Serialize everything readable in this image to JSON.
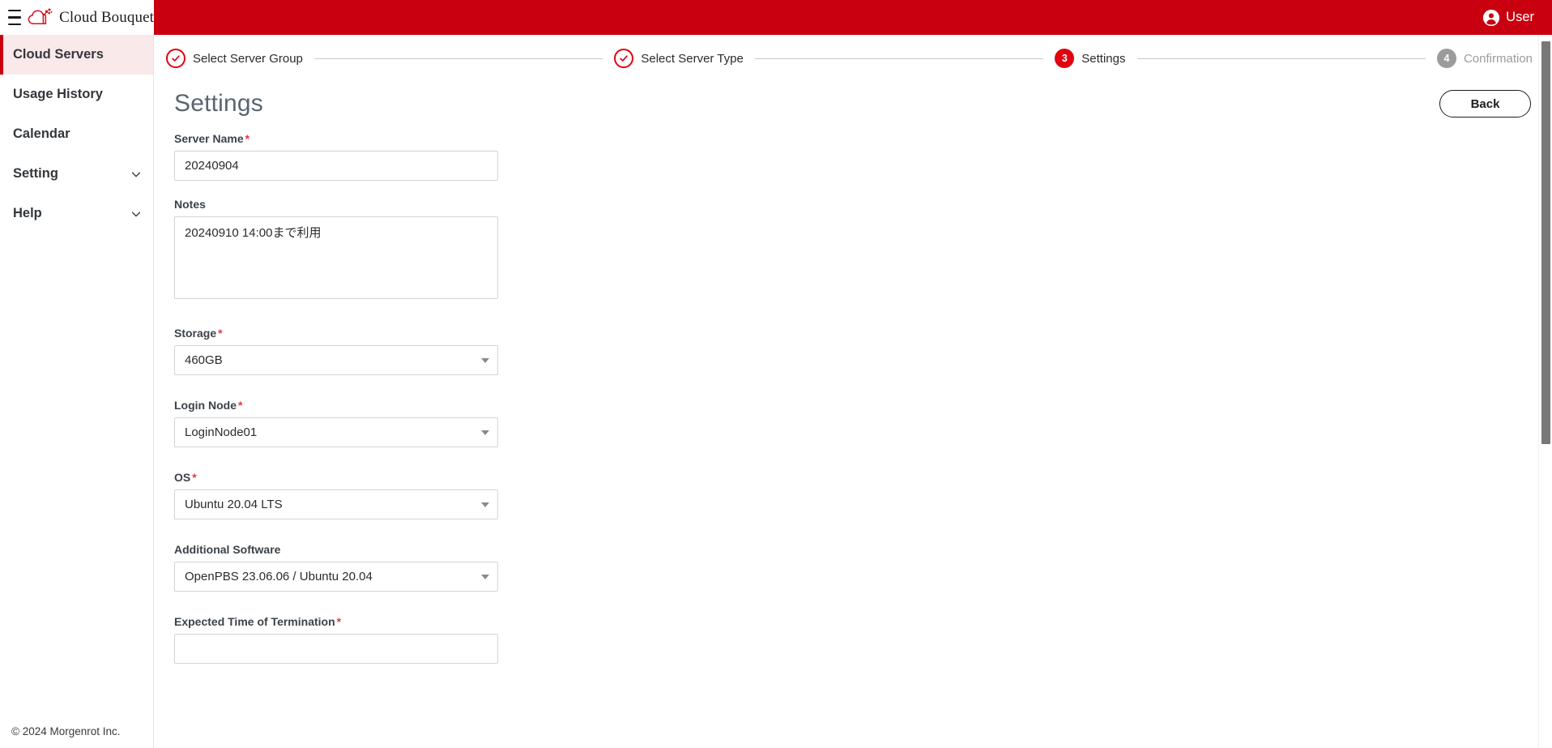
{
  "topbar": {
    "menu_icon": "hamburger-icon",
    "brand": "Cloud Bouquet",
    "logo_icon": "cloud-bouquet-logo",
    "user_icon": "user-avatar-icon",
    "user_label": "User",
    "background_color": "#c9000f"
  },
  "sidebar": {
    "items": [
      {
        "label": "Cloud Servers",
        "active": true,
        "expandable": false
      },
      {
        "label": "Usage History",
        "active": false,
        "expandable": false
      },
      {
        "label": "Calendar",
        "active": false,
        "expandable": false
      },
      {
        "label": "Setting",
        "active": false,
        "expandable": true,
        "chevron_icon": "chevron-down-icon"
      },
      {
        "label": "Help",
        "active": false,
        "expandable": true,
        "chevron_icon": "chevron-down-icon"
      }
    ],
    "active_accent_color": "#c9000f",
    "active_background_color": "#fae9ea",
    "footer": "© 2024 Morgenrot Inc."
  },
  "stepper": {
    "steps": [
      {
        "badge": "check-icon",
        "number": "1",
        "label": "Select Server Group",
        "state": "done"
      },
      {
        "badge": "check-icon",
        "number": "2",
        "label": "Select Server Type",
        "state": "done"
      },
      {
        "badge": "3",
        "number": "3",
        "label": "Settings",
        "state": "current"
      },
      {
        "badge": "4",
        "number": "4",
        "label": "Confirmation",
        "state": "todo"
      }
    ],
    "done_color": "#e2000f",
    "current_color": "#e2000f",
    "todo_color": "#9b9b9b"
  },
  "page": {
    "title": "Settings",
    "back_button": "Back"
  },
  "form": {
    "fields": [
      {
        "name": "server-name",
        "label": "Server Name",
        "required": true,
        "type": "text",
        "value": "20240904",
        "placeholder": ""
      },
      {
        "name": "notes",
        "label": "Notes",
        "required": false,
        "type": "textarea",
        "value": "20240910 14:00まで利用",
        "placeholder": ""
      },
      {
        "name": "storage",
        "label": "Storage",
        "required": true,
        "type": "select",
        "value": "460GB"
      },
      {
        "name": "login-node",
        "label": "Login Node",
        "required": true,
        "type": "select",
        "value": "LoginNode01"
      },
      {
        "name": "os",
        "label": "OS",
        "required": true,
        "type": "select",
        "value": "Ubuntu 20.04 LTS"
      },
      {
        "name": "additional-software",
        "label": "Additional Software",
        "required": false,
        "type": "select",
        "value": "OpenPBS 23.06.06 / Ubuntu 20.04"
      },
      {
        "name": "expected-time-of-termination",
        "label": "Expected Time of Termination",
        "required": true,
        "type": "text",
        "value": "",
        "placeholder": ""
      }
    ],
    "required_marker": "*"
  },
  "scrollbar": {
    "name": "vertical-scrollbar",
    "thumb_color": "#787878"
  }
}
